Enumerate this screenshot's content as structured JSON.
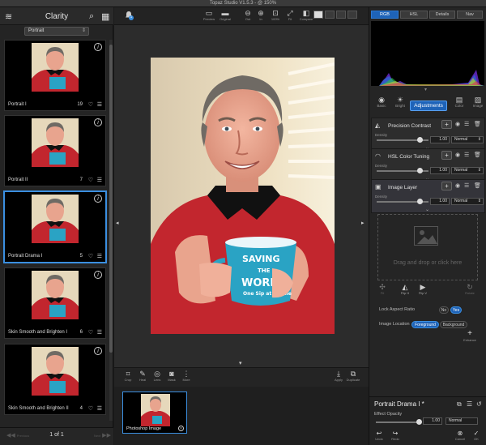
{
  "window": {
    "title": "Topaz Studio V1.5.3 - @ 150%"
  },
  "left_panel": {
    "title": "Clarity",
    "filter": "Portrait",
    "thumbnails": [
      {
        "name": "Portrait I",
        "count": "19"
      },
      {
        "name": "Portrait II",
        "count": "7"
      },
      {
        "name": "Portrait Drama I",
        "count": "5"
      },
      {
        "name": "Skin Smooth and Brighten I",
        "count": "6"
      },
      {
        "name": "Skin Smooth and Brighten II",
        "count": "4"
      }
    ],
    "pager": {
      "text": "1 of 1",
      "prev": "Previous",
      "next": "Next"
    }
  },
  "top_toolbar": {
    "buttons": [
      {
        "label": "Preview",
        "icon": "preview-icon"
      },
      {
        "label": "Original",
        "icon": "original-icon"
      },
      {
        "label": "Out",
        "icon": "zoom-out-icon"
      },
      {
        "label": "In",
        "icon": "zoom-in-icon"
      },
      {
        "label": "100%",
        "icon": "actual-size-icon"
      },
      {
        "label": "Fit",
        "icon": "fit-icon"
      },
      {
        "label": "Compare",
        "icon": "compare-icon"
      }
    ],
    "notification_count": "1"
  },
  "bottom_toolbar": {
    "left": [
      {
        "label": "Crop",
        "icon": "crop-icon"
      },
      {
        "label": "Heal",
        "icon": "heal-icon"
      },
      {
        "label": "Lens",
        "icon": "lens-icon"
      },
      {
        "label": "Mask",
        "icon": "mask-icon"
      },
      {
        "label": "More",
        "icon": "more-icon"
      }
    ],
    "right": [
      {
        "label": "Apply",
        "icon": "apply-icon"
      },
      {
        "label": "Duplicate",
        "icon": "duplicate-icon"
      }
    ]
  },
  "filmstrip": {
    "caption": "Photoshop Image"
  },
  "right_panel": {
    "tabs": [
      "RGB",
      "HSL",
      "Details",
      "Nav"
    ],
    "tool_row": [
      {
        "label": "Basic",
        "icon": "basic-icon"
      },
      {
        "label": "Bright",
        "icon": "bright-icon"
      },
      {
        "label": "Color",
        "icon": "color-icon"
      },
      {
        "label": "Image",
        "icon": "image-icon"
      }
    ],
    "adjustments_label": "Adjustments",
    "layers": [
      {
        "name": "Precision Contrast",
        "density_label": "Density",
        "value": "1.00",
        "blend": "Normal"
      },
      {
        "name": "HSL Color Tuning",
        "density_label": "Density",
        "value": "1.00",
        "blend": "Normal"
      },
      {
        "name": "Image Layer",
        "density_label": "Density",
        "value": "1.00",
        "blend": "Normal"
      }
    ],
    "dropzone_text": "Drag and drop or click here",
    "image_tools": [
      {
        "label": "Fit",
        "icon": "fit-icon",
        "on": false
      },
      {
        "label": "Flip H",
        "icon": "flip-h-icon",
        "on": true
      },
      {
        "label": "Flip V",
        "icon": "flip-v-icon",
        "on": true
      },
      {
        "label": "Rotate",
        "icon": "rotate-icon",
        "on": false
      }
    ],
    "lock_aspect": {
      "label": "Lock Aspect Ratio",
      "options": [
        "No",
        "Yes"
      ],
      "selected": "Yes"
    },
    "image_location": {
      "label": "Image Location",
      "options": [
        "Foreground",
        "Background"
      ],
      "selected": "Foreground"
    },
    "enhance_label": "Enhance",
    "footer": {
      "title": "Portrait Drama I *",
      "opacity_label": "Effect Opacity",
      "opacity_value": "1.00",
      "blend": "Normal",
      "buttons": [
        {
          "label": "Undo",
          "icon": "undo-icon"
        },
        {
          "label": "Redo",
          "icon": "redo-icon"
        },
        {
          "label": "Cancel",
          "icon": "cancel-icon"
        },
        {
          "label": "OK",
          "icon": "ok-icon"
        }
      ]
    }
  },
  "colors": {
    "accent": "#1e63b8",
    "selection": "#3b8fe0"
  }
}
